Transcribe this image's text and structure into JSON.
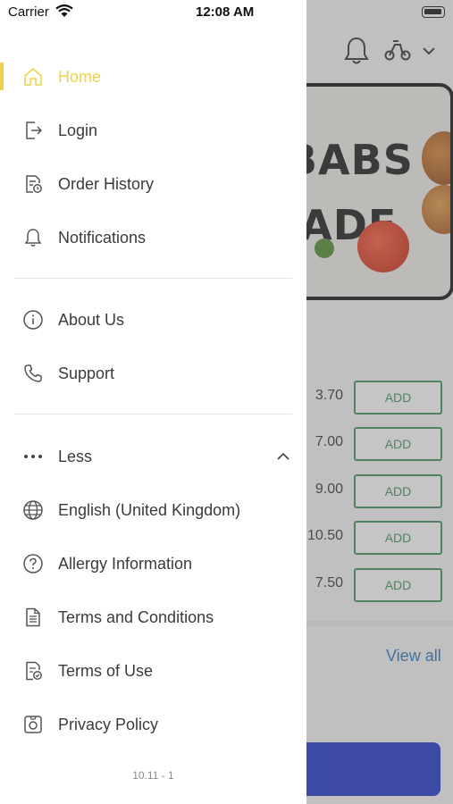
{
  "status_bar": {
    "carrier": "Carrier",
    "time": "12:08 AM"
  },
  "menu": {
    "primary": [
      {
        "label": "Home",
        "icon": "home-icon",
        "active": true
      },
      {
        "label": "Login",
        "icon": "login-icon"
      },
      {
        "label": "Order History",
        "icon": "order-history-icon"
      },
      {
        "label": "Notifications",
        "icon": "bell-icon"
      }
    ],
    "secondary": [
      {
        "label": "About Us",
        "icon": "info-icon"
      },
      {
        "label": "Support",
        "icon": "phone-icon"
      }
    ],
    "less_label": "Less",
    "more": [
      {
        "label": "English (United Kingdom)",
        "icon": "globe-icon"
      },
      {
        "label": "Allergy Information",
        "icon": "question-icon"
      },
      {
        "label": "Terms and Conditions",
        "icon": "document-icon"
      },
      {
        "label": "Terms of Use",
        "icon": "terms-check-icon"
      },
      {
        "label": "Privacy Policy",
        "icon": "privacy-icon"
      }
    ],
    "version": "10.11 - 1"
  },
  "background": {
    "banner_text": [
      "BABS",
      "IADE"
    ],
    "prices": [
      "3.70",
      "7.00",
      "9.00",
      "10.50",
      "7.50"
    ],
    "add_label": "ADD",
    "view_all": "View all"
  },
  "colors": {
    "accent": "#f0d24a",
    "add_green": "#3c8f5a",
    "link_blue": "#1f74c5",
    "cta_blue": "#1a35c6"
  }
}
